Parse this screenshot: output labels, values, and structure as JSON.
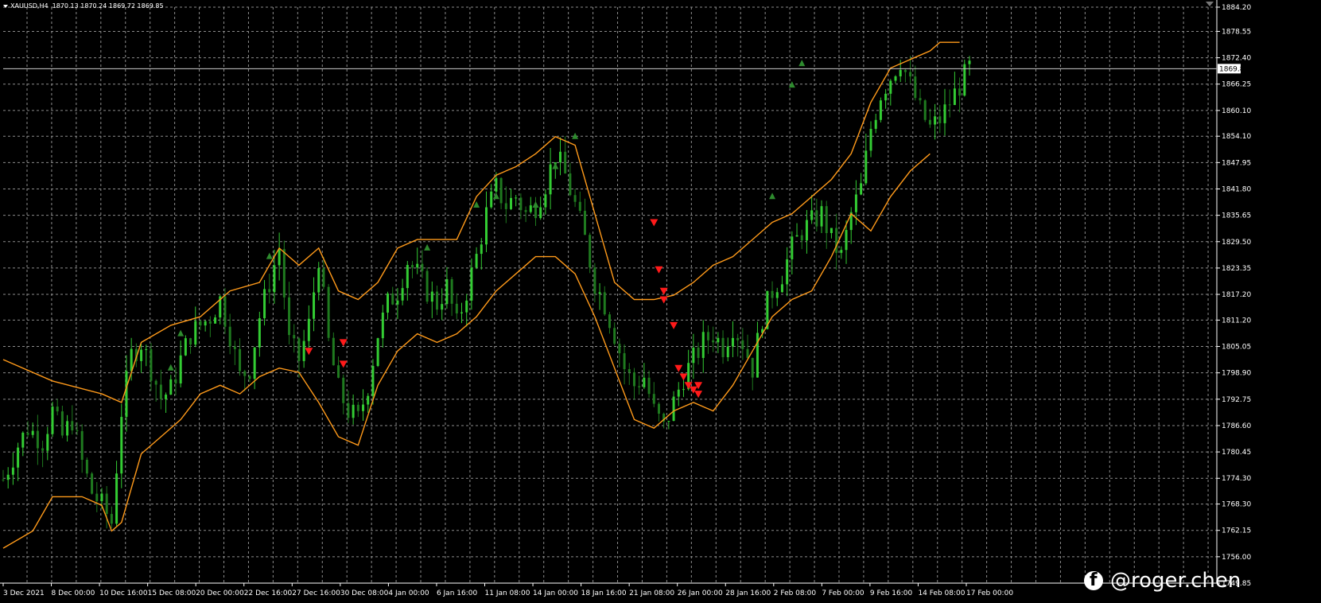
{
  "symbol_info": {
    "symbol": "XAUUSD,H4",
    "ohlc": "1870.13 1870.24 1869.72 1869.85"
  },
  "watermark": {
    "handle": "@roger.chen",
    "icon": "facebook-icon"
  },
  "colors": {
    "background": "#000000",
    "grid": "#8c8c8c",
    "bull_candle": "#33cc33",
    "bear_candle": "#1f7a1f",
    "band": "#ff9a1a",
    "sell_arrow": "#ff1a1a",
    "buy_arrow": "#2e8b2e",
    "axis_text": "#ffffff"
  },
  "chart_data": {
    "type": "candlestick",
    "title": "",
    "ylim": [
      1749.85,
      1884.2
    ],
    "y_ticks": [
      "1884.20",
      "1878.55",
      "1872.40",
      "1866.25",
      "1860.10",
      "1854.10",
      "1847.95",
      "1841.80",
      "1835.65",
      "1829.50",
      "1823.35",
      "1817.20",
      "1811.20",
      "1805.05",
      "1798.90",
      "1792.75",
      "1786.60",
      "1780.45",
      "1774.30",
      "1768.30",
      "1762.15",
      "1756.00",
      "1749.85"
    ],
    "current_price": "1869.85",
    "x_ticks": [
      "3 Dec 2021",
      "8 Dec 00:00",
      "10 Dec 16:00",
      "15 Dec 08:00",
      "20 Dec 00:00",
      "22 Dec 16:00",
      "27 Dec 16:00",
      "30 Dec 08:00",
      "4 Jan 00:00",
      "6 Jan 16:00",
      "11 Jan 08:00",
      "14 Jan 00:00",
      "18 Jan 16:00",
      "21 Jan 08:00",
      "26 Jan 00:00",
      "28 Jan 16:00",
      "2 Feb 08:00",
      "7 Feb 00:00",
      "9 Feb 16:00",
      "14 Feb 08:00",
      "17 Feb 00:00"
    ],
    "close_path": [
      [
        0,
        1774
      ],
      [
        3,
        1782
      ],
      [
        5,
        1786
      ],
      [
        8,
        1783
      ],
      [
        10,
        1790
      ],
      [
        12,
        1784
      ],
      [
        14,
        1788
      ],
      [
        16,
        1778
      ],
      [
        18,
        1771
      ],
      [
        20,
        1768
      ],
      [
        22,
        1764
      ],
      [
        24,
        1790
      ],
      [
        26,
        1803
      ],
      [
        28,
        1806
      ],
      [
        30,
        1800
      ],
      [
        32,
        1793
      ],
      [
        34,
        1795
      ],
      [
        36,
        1802
      ],
      [
        38,
        1808
      ],
      [
        40,
        1810
      ],
      [
        42,
        1812
      ],
      [
        44,
        1816
      ],
      [
        46,
        1808
      ],
      [
        48,
        1798
      ],
      [
        50,
        1800
      ],
      [
        52,
        1812
      ],
      [
        54,
        1820
      ],
      [
        56,
        1828
      ],
      [
        58,
        1806
      ],
      [
        60,
        1802
      ],
      [
        62,
        1810
      ],
      [
        64,
        1826
      ],
      [
        66,
        1806
      ],
      [
        68,
        1795
      ],
      [
        70,
        1790
      ],
      [
        72,
        1788
      ],
      [
        74,
        1796
      ],
      [
        76,
        1808
      ],
      [
        78,
        1815
      ],
      [
        80,
        1818
      ],
      [
        82,
        1825
      ],
      [
        84,
        1822
      ],
      [
        86,
        1818
      ],
      [
        88,
        1815
      ],
      [
        90,
        1819
      ],
      [
        92,
        1810
      ],
      [
        94,
        1818
      ],
      [
        96,
        1826
      ],
      [
        98,
        1836
      ],
      [
        100,
        1842
      ],
      [
        102,
        1838
      ],
      [
        104,
        1840
      ],
      [
        106,
        1836
      ],
      [
        108,
        1838
      ],
      [
        110,
        1843
      ],
      [
        112,
        1850
      ],
      [
        114,
        1845
      ],
      [
        116,
        1838
      ],
      [
        118,
        1830
      ],
      [
        120,
        1820
      ],
      [
        122,
        1815
      ],
      [
        124,
        1808
      ],
      [
        126,
        1800
      ],
      [
        128,
        1796
      ],
      [
        130,
        1798
      ],
      [
        132,
        1790
      ],
      [
        134,
        1786
      ],
      [
        136,
        1792
      ],
      [
        138,
        1798
      ],
      [
        140,
        1802
      ],
      [
        142,
        1806
      ],
      [
        144,
        1808
      ],
      [
        146,
        1805
      ],
      [
        148,
        1810
      ],
      [
        150,
        1806
      ],
      [
        152,
        1800
      ],
      [
        154,
        1812
      ],
      [
        156,
        1818
      ],
      [
        158,
        1822
      ],
      [
        160,
        1828
      ],
      [
        162,
        1832
      ],
      [
        164,
        1834
      ],
      [
        166,
        1836
      ],
      [
        168,
        1830
      ],
      [
        170,
        1826
      ],
      [
        172,
        1836
      ],
      [
        174,
        1842
      ],
      [
        176,
        1856
      ],
      [
        178,
        1864
      ],
      [
        180,
        1868
      ],
      [
        182,
        1872
      ],
      [
        184,
        1866
      ],
      [
        186,
        1860
      ],
      [
        188,
        1856
      ],
      [
        190,
        1858
      ],
      [
        192,
        1862
      ],
      [
        194,
        1866
      ],
      [
        196,
        1870
      ]
    ],
    "series": [
      {
        "name": "",
        "type": "band-upper",
        "points": [
          [
            0,
            1802
          ],
          [
            10,
            1797
          ],
          [
            20,
            1794
          ],
          [
            24,
            1792
          ],
          [
            28,
            1806
          ],
          [
            34,
            1810
          ],
          [
            40,
            1812
          ],
          [
            46,
            1818
          ],
          [
            52,
            1820
          ],
          [
            56,
            1828
          ],
          [
            60,
            1824
          ],
          [
            64,
            1828
          ],
          [
            68,
            1818
          ],
          [
            72,
            1816
          ],
          [
            76,
            1820
          ],
          [
            80,
            1828
          ],
          [
            84,
            1830
          ],
          [
            88,
            1830
          ],
          [
            92,
            1830
          ],
          [
            96,
            1840
          ],
          [
            100,
            1845
          ],
          [
            104,
            1847
          ],
          [
            108,
            1850
          ],
          [
            112,
            1854
          ],
          [
            116,
            1852
          ],
          [
            120,
            1836
          ],
          [
            124,
            1820
          ],
          [
            128,
            1816
          ],
          [
            132,
            1816
          ],
          [
            136,
            1817
          ],
          [
            140,
            1820
          ],
          [
            144,
            1824
          ],
          [
            148,
            1826
          ],
          [
            152,
            1830
          ],
          [
            156,
            1834
          ],
          [
            160,
            1836
          ],
          [
            164,
            1840
          ],
          [
            168,
            1844
          ],
          [
            172,
            1850
          ],
          [
            176,
            1862
          ],
          [
            180,
            1870
          ],
          [
            184,
            1872
          ],
          [
            188,
            1874
          ],
          [
            190,
            1876
          ],
          [
            194,
            1876
          ]
        ]
      },
      {
        "name": "",
        "type": "band-lower",
        "points": [
          [
            0,
            1758
          ],
          [
            6,
            1762
          ],
          [
            10,
            1770
          ],
          [
            16,
            1770
          ],
          [
            20,
            1768
          ],
          [
            22,
            1762
          ],
          [
            24,
            1764
          ],
          [
            28,
            1780
          ],
          [
            32,
            1784
          ],
          [
            36,
            1788
          ],
          [
            40,
            1794
          ],
          [
            44,
            1796
          ],
          [
            48,
            1794
          ],
          [
            52,
            1798
          ],
          [
            56,
            1800
          ],
          [
            60,
            1799
          ],
          [
            64,
            1792
          ],
          [
            68,
            1784
          ],
          [
            72,
            1782
          ],
          [
            76,
            1796
          ],
          [
            80,
            1804
          ],
          [
            84,
            1808
          ],
          [
            88,
            1806
          ],
          [
            92,
            1808
          ],
          [
            96,
            1812
          ],
          [
            100,
            1818
          ],
          [
            104,
            1822
          ],
          [
            108,
            1826
          ],
          [
            112,
            1826
          ],
          [
            116,
            1822
          ],
          [
            120,
            1812
          ],
          [
            124,
            1800
          ],
          [
            128,
            1788
          ],
          [
            132,
            1786
          ],
          [
            136,
            1790
          ],
          [
            140,
            1792
          ],
          [
            144,
            1790
          ],
          [
            148,
            1796
          ],
          [
            152,
            1804
          ],
          [
            156,
            1812
          ],
          [
            160,
            1816
          ],
          [
            164,
            1818
          ],
          [
            168,
            1826
          ],
          [
            172,
            1836
          ],
          [
            176,
            1832
          ],
          [
            180,
            1840
          ],
          [
            184,
            1846
          ],
          [
            188,
            1850
          ]
        ]
      }
    ],
    "sell_signals": [
      [
        62,
        1804
      ],
      [
        69,
        1806
      ],
      [
        69,
        1801
      ],
      [
        132,
        1834
      ],
      [
        133,
        1823
      ],
      [
        134,
        1818
      ],
      [
        134,
        1816
      ],
      [
        136,
        1810
      ],
      [
        137,
        1800
      ],
      [
        138,
        1798
      ],
      [
        139,
        1796
      ],
      [
        140,
        1795
      ],
      [
        141,
        1796
      ],
      [
        141,
        1794
      ]
    ],
    "buy_signals": [
      [
        34,
        1800
      ],
      [
        36,
        1808
      ],
      [
        54,
        1826
      ],
      [
        86,
        1828
      ],
      [
        96,
        1838
      ],
      [
        100,
        1840
      ],
      [
        108,
        1838
      ],
      [
        112,
        1847
      ],
      [
        116,
        1854
      ],
      [
        156,
        1840
      ],
      [
        160,
        1866
      ],
      [
        162,
        1871
      ]
    ]
  }
}
